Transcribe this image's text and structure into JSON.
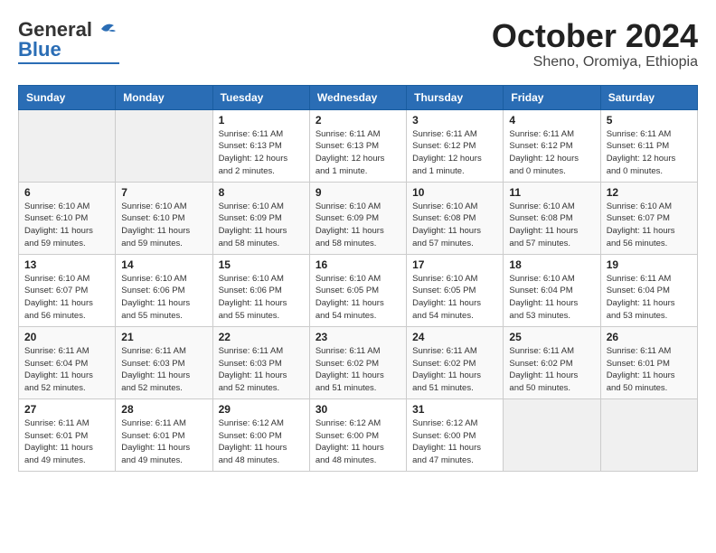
{
  "logo": {
    "general": "General",
    "blue": "Blue"
  },
  "header": {
    "month": "October 2024",
    "location": "Sheno, Oromiya, Ethiopia"
  },
  "weekdays": [
    "Sunday",
    "Monday",
    "Tuesday",
    "Wednesday",
    "Thursday",
    "Friday",
    "Saturday"
  ],
  "weeks": [
    [
      {
        "day": "",
        "info": ""
      },
      {
        "day": "",
        "info": ""
      },
      {
        "day": "1",
        "info": "Sunrise: 6:11 AM\nSunset: 6:13 PM\nDaylight: 12 hours\nand 2 minutes."
      },
      {
        "day": "2",
        "info": "Sunrise: 6:11 AM\nSunset: 6:13 PM\nDaylight: 12 hours\nand 1 minute."
      },
      {
        "day": "3",
        "info": "Sunrise: 6:11 AM\nSunset: 6:12 PM\nDaylight: 12 hours\nand 1 minute."
      },
      {
        "day": "4",
        "info": "Sunrise: 6:11 AM\nSunset: 6:12 PM\nDaylight: 12 hours\nand 0 minutes."
      },
      {
        "day": "5",
        "info": "Sunrise: 6:11 AM\nSunset: 6:11 PM\nDaylight: 12 hours\nand 0 minutes."
      }
    ],
    [
      {
        "day": "6",
        "info": "Sunrise: 6:10 AM\nSunset: 6:10 PM\nDaylight: 11 hours\nand 59 minutes."
      },
      {
        "day": "7",
        "info": "Sunrise: 6:10 AM\nSunset: 6:10 PM\nDaylight: 11 hours\nand 59 minutes."
      },
      {
        "day": "8",
        "info": "Sunrise: 6:10 AM\nSunset: 6:09 PM\nDaylight: 11 hours\nand 58 minutes."
      },
      {
        "day": "9",
        "info": "Sunrise: 6:10 AM\nSunset: 6:09 PM\nDaylight: 11 hours\nand 58 minutes."
      },
      {
        "day": "10",
        "info": "Sunrise: 6:10 AM\nSunset: 6:08 PM\nDaylight: 11 hours\nand 57 minutes."
      },
      {
        "day": "11",
        "info": "Sunrise: 6:10 AM\nSunset: 6:08 PM\nDaylight: 11 hours\nand 57 minutes."
      },
      {
        "day": "12",
        "info": "Sunrise: 6:10 AM\nSunset: 6:07 PM\nDaylight: 11 hours\nand 56 minutes."
      }
    ],
    [
      {
        "day": "13",
        "info": "Sunrise: 6:10 AM\nSunset: 6:07 PM\nDaylight: 11 hours\nand 56 minutes."
      },
      {
        "day": "14",
        "info": "Sunrise: 6:10 AM\nSunset: 6:06 PM\nDaylight: 11 hours\nand 55 minutes."
      },
      {
        "day": "15",
        "info": "Sunrise: 6:10 AM\nSunset: 6:06 PM\nDaylight: 11 hours\nand 55 minutes."
      },
      {
        "day": "16",
        "info": "Sunrise: 6:10 AM\nSunset: 6:05 PM\nDaylight: 11 hours\nand 54 minutes."
      },
      {
        "day": "17",
        "info": "Sunrise: 6:10 AM\nSunset: 6:05 PM\nDaylight: 11 hours\nand 54 minutes."
      },
      {
        "day": "18",
        "info": "Sunrise: 6:10 AM\nSunset: 6:04 PM\nDaylight: 11 hours\nand 53 minutes."
      },
      {
        "day": "19",
        "info": "Sunrise: 6:11 AM\nSunset: 6:04 PM\nDaylight: 11 hours\nand 53 minutes."
      }
    ],
    [
      {
        "day": "20",
        "info": "Sunrise: 6:11 AM\nSunset: 6:04 PM\nDaylight: 11 hours\nand 52 minutes."
      },
      {
        "day": "21",
        "info": "Sunrise: 6:11 AM\nSunset: 6:03 PM\nDaylight: 11 hours\nand 52 minutes."
      },
      {
        "day": "22",
        "info": "Sunrise: 6:11 AM\nSunset: 6:03 PM\nDaylight: 11 hours\nand 52 minutes."
      },
      {
        "day": "23",
        "info": "Sunrise: 6:11 AM\nSunset: 6:02 PM\nDaylight: 11 hours\nand 51 minutes."
      },
      {
        "day": "24",
        "info": "Sunrise: 6:11 AM\nSunset: 6:02 PM\nDaylight: 11 hours\nand 51 minutes."
      },
      {
        "day": "25",
        "info": "Sunrise: 6:11 AM\nSunset: 6:02 PM\nDaylight: 11 hours\nand 50 minutes."
      },
      {
        "day": "26",
        "info": "Sunrise: 6:11 AM\nSunset: 6:01 PM\nDaylight: 11 hours\nand 50 minutes."
      }
    ],
    [
      {
        "day": "27",
        "info": "Sunrise: 6:11 AM\nSunset: 6:01 PM\nDaylight: 11 hours\nand 49 minutes."
      },
      {
        "day": "28",
        "info": "Sunrise: 6:11 AM\nSunset: 6:01 PM\nDaylight: 11 hours\nand 49 minutes."
      },
      {
        "day": "29",
        "info": "Sunrise: 6:12 AM\nSunset: 6:00 PM\nDaylight: 11 hours\nand 48 minutes."
      },
      {
        "day": "30",
        "info": "Sunrise: 6:12 AM\nSunset: 6:00 PM\nDaylight: 11 hours\nand 48 minutes."
      },
      {
        "day": "31",
        "info": "Sunrise: 6:12 AM\nSunset: 6:00 PM\nDaylight: 11 hours\nand 47 minutes."
      },
      {
        "day": "",
        "info": ""
      },
      {
        "day": "",
        "info": ""
      }
    ]
  ]
}
